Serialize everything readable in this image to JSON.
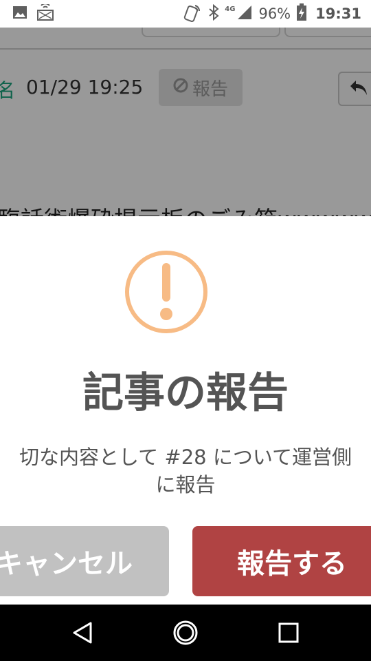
{
  "status_bar": {
    "left_icons": [
      "image-icon",
      "cast-notification-icon"
    ],
    "right_icons": [
      "nfc-icon",
      "bluetooth-icon",
      "signal-icon",
      "battery-icon"
    ],
    "network_label": "4G",
    "battery_percent": "96%",
    "time": "19:31"
  },
  "background": {
    "author_fragment": "名",
    "date": "01/29 19:25",
    "report_button_label": "報告",
    "body_text": "臨話術爆砕掲示板のごみ箱wwwwww"
  },
  "modal": {
    "icon": "exclamation-circle-icon",
    "title": "記事の報告",
    "description_line1": "切な内容として #28 について運営側",
    "description_line2": "に報告",
    "cancel_label": "キャンセル",
    "confirm_label": "報告する",
    "colors": {
      "icon": "#f7bb85",
      "confirm": "#b04343",
      "cancel": "#c1c1c1",
      "text": "#545454"
    }
  },
  "nav_bar": {
    "buttons": [
      "back-icon",
      "home-icon",
      "recents-icon"
    ]
  }
}
